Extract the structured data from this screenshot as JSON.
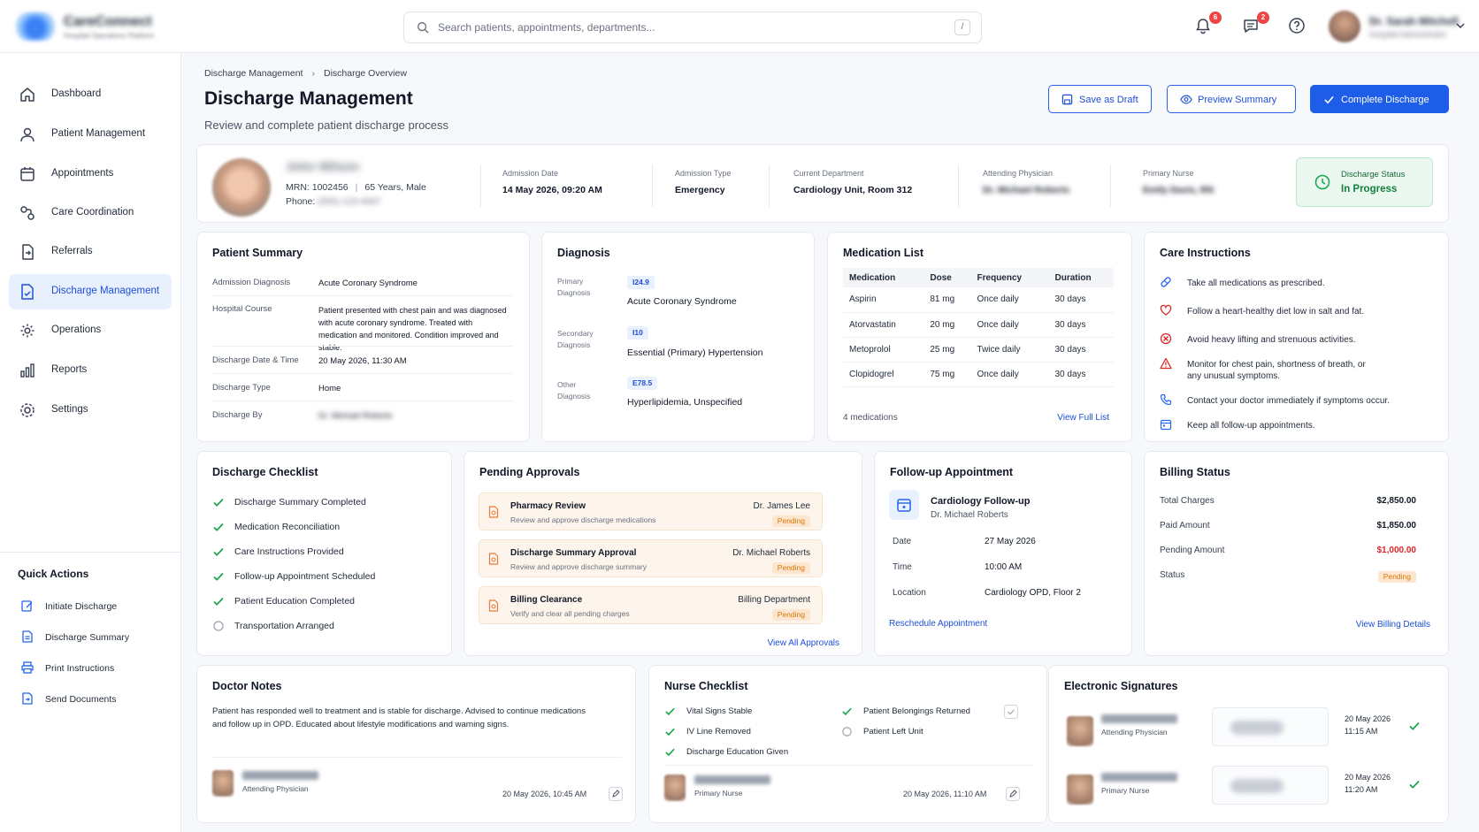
{
  "app": {
    "logo_line1": "CareConnect",
    "logo_line2": "Hospital Operations Platform"
  },
  "search": {
    "placeholder": "Search patients, appointments, departments...",
    "shortcut": "/"
  },
  "topbar": {
    "notifications_count": "6",
    "messages_count": "2",
    "user_name": "Dr. Sarah Mitchell",
    "user_role": "Hospital Administrator"
  },
  "sidebar": {
    "items": [
      {
        "label": "Dashboard",
        "icon": "home-icon"
      },
      {
        "label": "Patient Management",
        "icon": "user-icon"
      },
      {
        "label": "Appointments",
        "icon": "calendar-icon"
      },
      {
        "label": "Care Coordination",
        "icon": "coordination-icon"
      },
      {
        "label": "Referrals",
        "icon": "referral-icon"
      },
      {
        "label": "Discharge Management",
        "icon": "discharge-icon",
        "active": true
      },
      {
        "label": "Operations",
        "icon": "operations-gear-icon"
      },
      {
        "label": "Reports",
        "icon": "bar-chart-icon"
      },
      {
        "label": "Settings",
        "icon": "settings-gear-icon"
      }
    ],
    "quick_actions_title": "Quick Actions",
    "quick_actions": [
      {
        "label": "Initiate Discharge",
        "icon": "edit-icon"
      },
      {
        "label": "Discharge Summary",
        "icon": "document-icon"
      },
      {
        "label": "Print Instructions",
        "icon": "printer-icon"
      },
      {
        "label": "Send Documents",
        "icon": "send-icon"
      }
    ]
  },
  "header": {
    "breadcrumb": [
      "Discharge Management",
      "Discharge Overview"
    ],
    "title": "Discharge Management",
    "subtitle": "Review and complete patient discharge process",
    "buttons": {
      "draft": "Save as Draft",
      "preview": "Preview Summary",
      "complete": "Complete Discharge"
    }
  },
  "patient": {
    "name": "John Wilson",
    "mrn": "MRN: 1002456",
    "age_sex": "65 Years, Male",
    "phone_label": "Phone:",
    "phone": "(555) 123-4567",
    "admission_date_label": "Admission Date",
    "admission_date": "14 May 2026, 09:20 AM",
    "admission_type_label": "Admission Type",
    "admission_type": "Emergency",
    "department_label": "Current Department",
    "department": "Cardiology Unit, Room 312",
    "physician_label": "Attending Physician",
    "physician": "Dr. Michael Roberts",
    "nurse_label": "Primary Nurse",
    "nurse": "Emily Davis, RN",
    "status_label": "Discharge Status",
    "status": "In Progress",
    "status_color": "#15803d"
  },
  "patient_summary": {
    "title": "Patient Summary",
    "rows": [
      {
        "k": "Admission Diagnosis",
        "v": "Acute Coronary Syndrome"
      },
      {
        "k": "Hospital Course",
        "v": "Patient presented with chest pain and was diagnosed with acute coronary syndrome. Treated with medication and monitored. Condition improved and stable."
      },
      {
        "k": "Discharge Date & Time",
        "v": "20 May 2026, 11:30 AM"
      },
      {
        "k": "Discharge Type",
        "v": "Home"
      },
      {
        "k": "Discharge By",
        "v": "Dr. Michael Roberts"
      }
    ]
  },
  "diagnosis": {
    "title": "Diagnosis",
    "items": [
      {
        "k": "Primary Diagnosis",
        "code": "I24.9",
        "v": "Acute Coronary Syndrome"
      },
      {
        "k": "Secondary Diagnosis",
        "code": "I10",
        "v": "Essential (Primary) Hypertension"
      },
      {
        "k": "Other Diagnosis",
        "code": "E78.5",
        "v": "Hyperlipidemia, Unspecified"
      }
    ]
  },
  "medications": {
    "title": "Medication List",
    "headers": [
      "Medication",
      "Dose",
      "Frequency",
      "Duration"
    ],
    "rows": [
      [
        "Aspirin",
        "81 mg",
        "Once daily",
        "30 days"
      ],
      [
        "Atorvastatin",
        "20 mg",
        "Once daily",
        "30 days"
      ],
      [
        "Metoprolol",
        "25 mg",
        "Twice daily",
        "30 days"
      ],
      [
        "Clopidogrel",
        "75 mg",
        "Once daily",
        "30 days"
      ]
    ],
    "count": "4 medications",
    "link": "View Full List"
  },
  "care_instructions": {
    "title": "Care Instructions",
    "items": [
      {
        "text": "Take all medications as prescribed.",
        "icon": "pill-icon",
        "color": "#2563eb"
      },
      {
        "text": "Follow a heart-healthy diet low in salt and fat.",
        "icon": "heart-icon",
        "color": "#dc2626"
      },
      {
        "text": "Avoid heavy lifting and strenuous activities.",
        "icon": "ban-icon",
        "color": "#dc2626"
      },
      {
        "text": "Monitor for chest pain, shortness of breath, or any unusual symptoms.",
        "icon": "warning-icon",
        "color": "#dc2626"
      },
      {
        "text": "Contact your doctor immediately if symptoms occur.",
        "icon": "phone-icon",
        "color": "#2563eb"
      },
      {
        "text": "Keep all follow-up appointments.",
        "icon": "calendar-icon",
        "color": "#2563eb"
      }
    ]
  },
  "checklist": {
    "title": "Discharge Checklist",
    "items": [
      {
        "text": "Discharge Summary Completed",
        "done": true
      },
      {
        "text": "Medication Reconciliation",
        "done": true
      },
      {
        "text": "Care Instructions Provided",
        "done": true
      },
      {
        "text": "Follow-up Appointment Scheduled",
        "done": true
      },
      {
        "text": "Patient Education Completed",
        "done": true
      },
      {
        "text": "Transportation Arranged",
        "done": false
      }
    ]
  },
  "approvals": {
    "title": "Pending Approvals",
    "items": [
      {
        "title": "Pharmacy Review",
        "desc": "Review and approve discharge medications",
        "who": "Dr. James Lee",
        "status": "Pending"
      },
      {
        "title": "Discharge Summary Approval",
        "desc": "Review and approve discharge summary",
        "who": "Dr. Michael Roberts",
        "status": "Pending"
      },
      {
        "title": "Billing Clearance",
        "desc": "Verify and clear all pending charges",
        "who": "Billing Department",
        "status": "Pending"
      }
    ],
    "link": "View All Approvals"
  },
  "followup": {
    "title": "Follow-up Appointment",
    "name": "Cardiology Follow-up",
    "doctor": "Dr. Michael Roberts",
    "rows": [
      {
        "k": "Date",
        "v": "27 May 2026"
      },
      {
        "k": "Time",
        "v": "10:00 AM"
      },
      {
        "k": "Location",
        "v": "Cardiology OPD, Floor 2"
      }
    ],
    "link": "Reschedule Appointment"
  },
  "billing": {
    "title": "Billing Status",
    "rows": [
      {
        "k": "Total Charges",
        "v": "$2,850.00"
      },
      {
        "k": "Paid Amount",
        "v": "$1,850.00"
      },
      {
        "k": "Pending Amount",
        "v": "$1,000.00",
        "color": "#dc2626"
      }
    ],
    "status_label": "Status",
    "status": "Pending",
    "link": "View Billing Details"
  },
  "doctor_notes": {
    "title": "Doctor Notes",
    "text": "Patient has responded well to treatment and is stable for discharge. Advised to continue medications and follow up in OPD. Educated about lifestyle modifications and warning signs.",
    "author_role": "Attending Physician",
    "timestamp": "20 May 2026, 10:45 AM"
  },
  "nurse_checklist": {
    "title": "Nurse Checklist",
    "left": [
      {
        "text": "Vital Signs Stable",
        "done": true
      },
      {
        "text": "IV Line Removed",
        "done": true
      },
      {
        "text": "Discharge Education Given",
        "done": true
      }
    ],
    "right": [
      {
        "text": "Patient Belongings Returned",
        "done": true
      },
      {
        "text": "Patient Left Unit",
        "done": false
      }
    ],
    "author_role": "Primary Nurse",
    "timestamp": "20 May 2026, 11:10 AM"
  },
  "signatures": {
    "title": "Electronic Signatures",
    "items": [
      {
        "role": "Attending Physician",
        "date": "20 May 2026",
        "time": "11:15 AM"
      },
      {
        "role": "Primary Nurse",
        "date": "20 May 2026",
        "time": "11:20 AM"
      }
    ]
  }
}
